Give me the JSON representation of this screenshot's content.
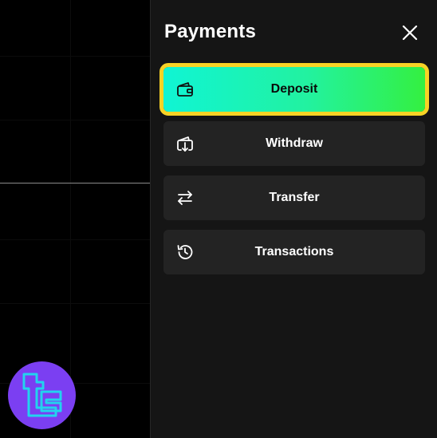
{
  "panel": {
    "title": "Payments",
    "close_icon": "close-icon"
  },
  "menu": {
    "items": [
      {
        "label": "Deposit",
        "icon": "wallet-icon",
        "active": true
      },
      {
        "label": "Withdraw",
        "icon": "withdraw-icon",
        "active": false
      },
      {
        "label": "Transfer",
        "icon": "transfer-arrows-icon",
        "active": false
      },
      {
        "label": "Transactions",
        "icon": "history-icon",
        "active": false
      }
    ]
  },
  "brand": {
    "logo_icon": "brand-logo-icon",
    "badge_color": "#7b3ff2",
    "logo_color": "#22d3ee"
  },
  "colors": {
    "panel_bg": "#151515",
    "item_bg": "#232323",
    "active_gradient_start": "#10f4d4",
    "active_gradient_end": "#34f040",
    "active_outline": "#f8d225"
  }
}
